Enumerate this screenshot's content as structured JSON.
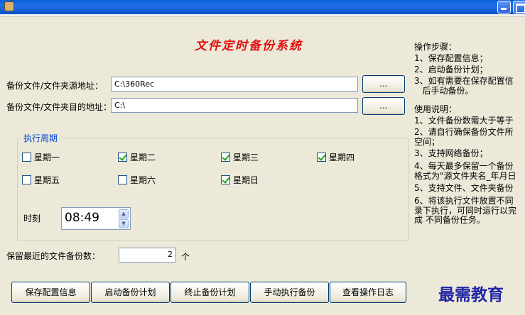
{
  "app": {
    "title": "文件定时备份系统"
  },
  "source": {
    "label": "备份文件/文件夹源地址：",
    "value": "C:\\360Rec",
    "browse_label": "..."
  },
  "dest": {
    "label": "备份文件/文件夹目的地址：",
    "value": "C:\\",
    "browse_label": "..."
  },
  "schedule": {
    "legend": "执行周期",
    "days": [
      {
        "label": "星期一",
        "checked": false
      },
      {
        "label": "星期二",
        "checked": true
      },
      {
        "label": "星期三",
        "checked": true
      },
      {
        "label": "星期四",
        "checked": true
      },
      {
        "label": "星期五",
        "checked": false
      },
      {
        "label": "星期六",
        "checked": false
      },
      {
        "label": "星期日",
        "checked": true
      }
    ],
    "time_label": "时刻",
    "time_value": "08:49"
  },
  "retain": {
    "label": "保留最近的文件备份数：",
    "value": "2",
    "unit": "个"
  },
  "buttons": {
    "save": "保存配置信息",
    "start": "启动备份计划",
    "stop": "终止备份计划",
    "manual": "手动执行备份",
    "log": "查看操作日志"
  },
  "help": {
    "steps_title": "操作步骤：",
    "steps": [
      "1、保存配置信息；",
      "2、启动备份计划；",
      "3、如有需要在保存配置信",
      "   后手动备份。"
    ],
    "usage_title": "使用说明：",
    "usage": [
      "1、文件备份数需大于等于",
      "2、请自行确保备份文件所",
      "空间；",
      "3、支持网络备份；",
      "4、每天最多保留一个备份",
      "格式为\"源文件夹名_年月日",
      "5、支持文件、文件夹备份",
      "6、将该执行文件放置不同",
      "录下执行，可同时运行以完",
      "成 不同备份任务。"
    ]
  },
  "watermark": "最需教育"
}
